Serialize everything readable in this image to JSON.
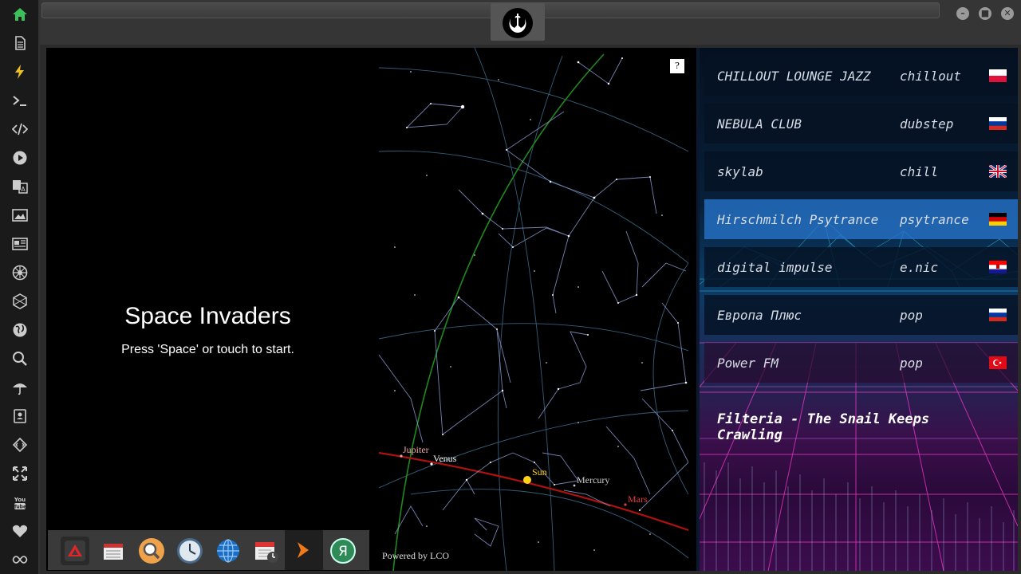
{
  "game": {
    "title": "Space Invaders",
    "subtitle": "Press 'Space' or touch to start."
  },
  "skymap": {
    "help": "?",
    "powered_by": "Powered by LCO",
    "planets": {
      "jupiter": "Jupiter",
      "venus": "Venus",
      "sun": "Sun",
      "mercury": "Mercury",
      "mars": "Mars"
    }
  },
  "radio": {
    "stations": [
      {
        "name": "CHILLOUT LOUNGE JAZZ",
        "genre": "chillout",
        "flag": "poland-flag"
      },
      {
        "name": "NEBULA CLUB",
        "genre": "dubstep",
        "flag": "russia-flag"
      },
      {
        "name": "skylab",
        "genre": "chill",
        "flag": "uk-flag"
      },
      {
        "name": "Hirschmilch Psytrance",
        "genre": "psytrance",
        "flag": "germany-flag"
      },
      {
        "name": "digital impulse",
        "genre": "e.nic",
        "flag": "croatia-flag"
      },
      {
        "name": "Европа Плюс",
        "genre": "pop",
        "flag": "russia-flag"
      },
      {
        "name": "Power FM",
        "genre": "pop",
        "flag": "turkey-flag"
      }
    ],
    "now_playing": "Filteria - The Snail Keeps Crawling"
  },
  "colors": {
    "accent_green": "#3cc15a",
    "planet_sun": "#ffd21a",
    "planet_mars": "#e03a3a",
    "ecliptic": "#b01010",
    "horizon": "#1e8a1e"
  }
}
